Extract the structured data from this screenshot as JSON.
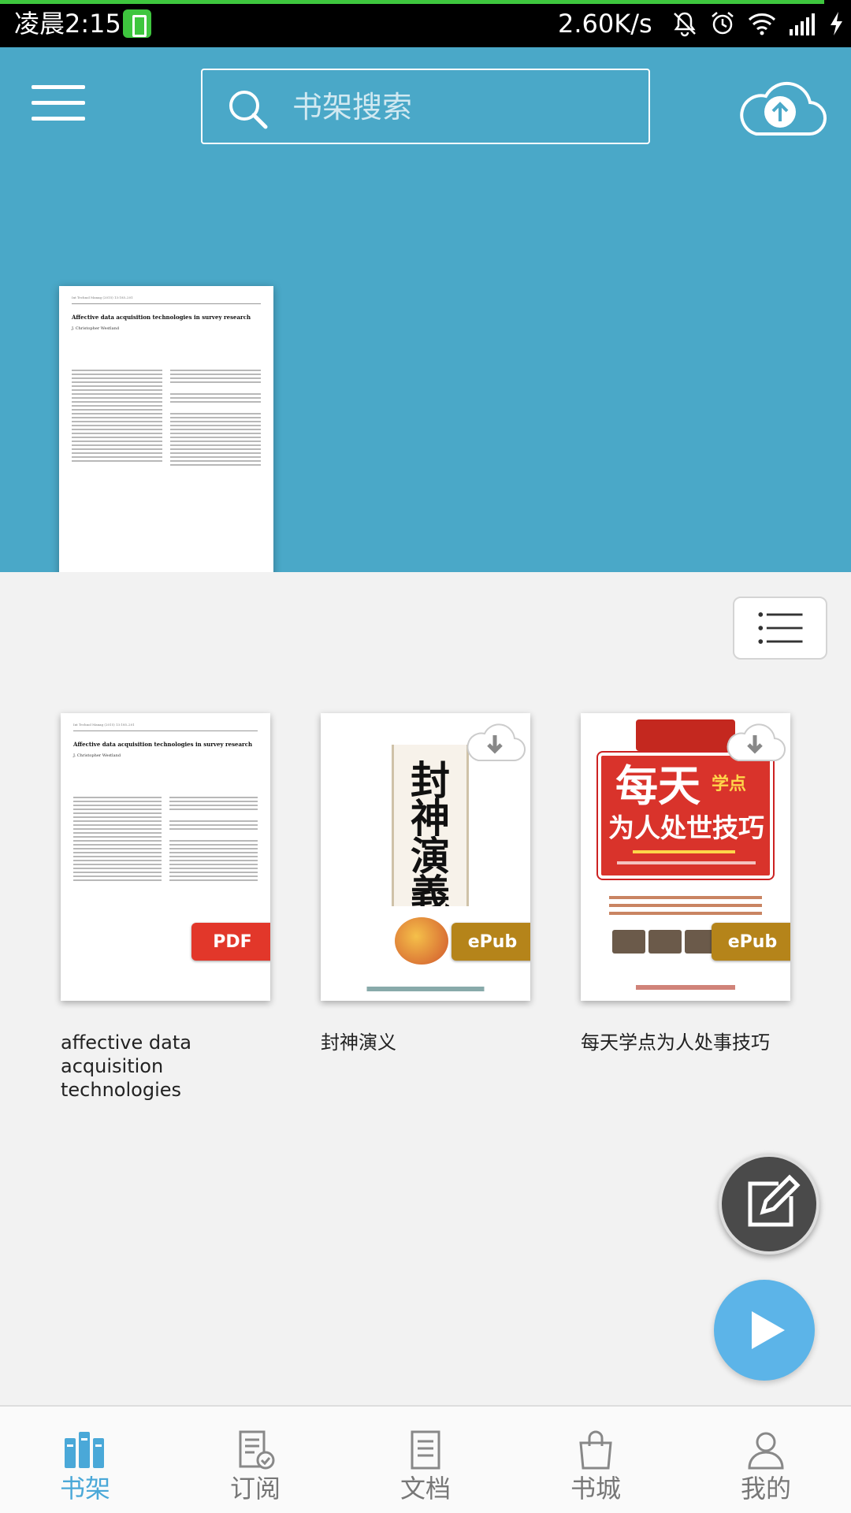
{
  "status_bar": {
    "time": "凌晨2:15",
    "net_speed": "2.60K/s",
    "icons": [
      "battery-saver-icon",
      "mute-icon",
      "alarm-icon",
      "wifi-icon",
      "signal-icon",
      "charging-icon"
    ]
  },
  "header": {
    "menu_icon": "hamburger-menu-icon",
    "search_placeholder": "书架搜索",
    "upload_icon": "cloud-upload-icon"
  },
  "featured_book": {
    "journal_line": "Int Technol Manag (2015) 13:185–201",
    "title": "Affective data acquisition technologies in survey research",
    "author": "J. Christopher Westland"
  },
  "books": [
    {
      "title": "affective data acquisition technologies",
      "format_badge": "PDF",
      "cover_title": "Affective data acquisition technologies in survey research",
      "cover_author": "J. Christopher Westland",
      "cover_journal_line": "Int Technol Manag (2015) 13:185–201"
    },
    {
      "title": "封神演义",
      "format_badge": "ePub",
      "cover_text": [
        "封",
        "神",
        "演",
        "義"
      ],
      "cloud_icon": "cloud-download-icon"
    },
    {
      "title": "每天学点为人处事技巧",
      "format_badge": "ePub",
      "cover_line1": "每天",
      "cover_line1_small": "学点",
      "cover_line2": "为人处世技巧",
      "cloud_icon": "cloud-download-icon"
    }
  ],
  "bottom_nav": [
    {
      "label": "书架",
      "icon": "bookshelf-icon",
      "active": true
    },
    {
      "label": "订阅",
      "icon": "subscription-icon",
      "active": false
    },
    {
      "label": "文档",
      "icon": "document-icon",
      "active": false
    },
    {
      "label": "书城",
      "icon": "shopping-bag-icon",
      "active": false
    },
    {
      "label": "我的",
      "icon": "profile-icon",
      "active": false
    }
  ],
  "colors": {
    "header_bg": "#4aa8c8",
    "accent": "#4aa8d8",
    "pdf_badge": "#e2372a",
    "epub_badge": "#b5841a",
    "status_progress": "#3ec63e"
  }
}
